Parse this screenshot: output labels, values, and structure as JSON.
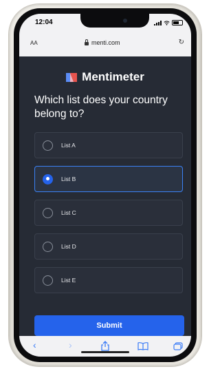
{
  "status": {
    "time": "12:04"
  },
  "browser": {
    "text_size_label": "AA",
    "url": "menti.com",
    "reload_glyph": "↻"
  },
  "brand": {
    "name": "Mentimeter"
  },
  "poll": {
    "question": "Which list does your country belong to?",
    "options": [
      {
        "label": "List A",
        "selected": false
      },
      {
        "label": "List B",
        "selected": true
      },
      {
        "label": "List C",
        "selected": false
      },
      {
        "label": "List D",
        "selected": false
      },
      {
        "label": "List E",
        "selected": false
      }
    ],
    "submit_label": "Submit"
  },
  "toolbar": {
    "back_glyph": "‹",
    "forward_glyph": "›",
    "share_glyph": "⇪",
    "bookmarks_glyph": "📖",
    "tabs_glyph": "⧉"
  },
  "colors": {
    "background": "#262b35",
    "accent": "#2563eb",
    "selected_border": "#3b82f6",
    "logo_red": "#e8544e",
    "logo_blue": "#5b8cf5"
  }
}
